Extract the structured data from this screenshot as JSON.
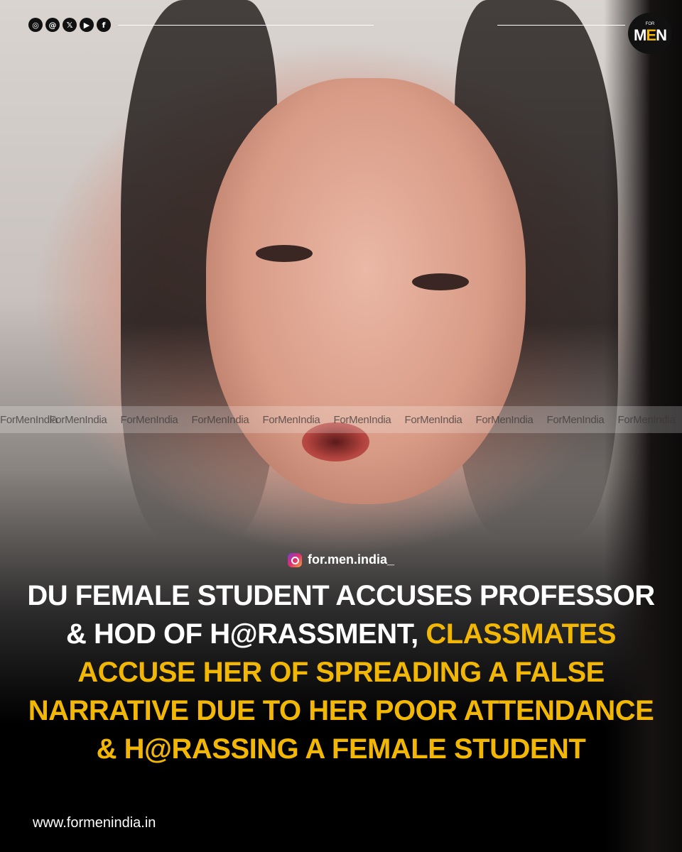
{
  "social_icons": [
    "instagram-icon",
    "threads-icon",
    "x-icon",
    "youtube-icon",
    "facebook-icon"
  ],
  "brand": {
    "logo_small_text": "FOR",
    "logo_text_part1": "M",
    "logo_text_part2": "E",
    "logo_text_part3": "N",
    "accent_color": "#f2b705"
  },
  "watermark": {
    "repeated_text": [
      "ForMenIndia",
      "ForMenIndia",
      "ForMenIndia",
      "ForMenIndia",
      "ForMenIndia",
      "ForMenIndia",
      "ForMenIndia",
      "ForMenIndia",
      "ForMenIndia",
      "ForMenIndia"
    ]
  },
  "handle": "for.men.india_",
  "headline": {
    "white_part": "DU FEMALE STUDENT ACCUSES PROFESSOR & HOD OF H@RASSMENT,",
    "yellow_part": "CLASSMATES ACCUSE HER OF SPREADING A FALSE NARRATIVE DUE TO HER POOR ATTENDANCE & H@RASSING A FEMALE STUDENT"
  },
  "website": "www.formenindia.in"
}
